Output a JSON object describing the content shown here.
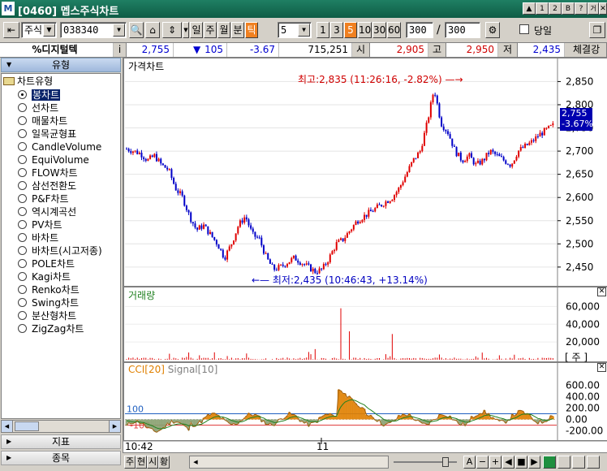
{
  "window": {
    "title": "[0460] 멥스주식차트",
    "logo": "M",
    "controls": [
      "&",
      "1",
      "2",
      "B",
      "?",
      "거",
      "X"
    ]
  },
  "toolbar": {
    "market_label": "주식",
    "code_value": "038340",
    "period_buttons": [
      "일",
      "주",
      "월",
      "분",
      "틱"
    ],
    "active_period": "틱",
    "interval_value": "5",
    "interval_buttons": [
      "1",
      "3",
      "5",
      "10",
      "30",
      "60"
    ],
    "active_interval": "5",
    "count_value": "300",
    "slash": "/",
    "total_value": "300",
    "today_label": "당일"
  },
  "quote": {
    "name": "%디지털텍",
    "info_label": "i",
    "price": "2,755",
    "change_arrow": "▼",
    "change": "105",
    "change_pct": "-3.67",
    "volume": "715,251",
    "open_label": "시",
    "open": "2,905",
    "high_label": "고",
    "high": "2,950",
    "low_label": "저",
    "low": "2,435",
    "exec_label": "체결강"
  },
  "sidebar": {
    "head": "유형",
    "tree_root": "차트유형",
    "items": [
      {
        "label": "봉차트",
        "selected": true
      },
      {
        "label": "선차트",
        "selected": false
      },
      {
        "label": "매물차트",
        "selected": false
      },
      {
        "label": "일목균형표",
        "selected": false
      },
      {
        "label": "CandleVolume",
        "selected": false
      },
      {
        "label": "EquiVolume",
        "selected": false
      },
      {
        "label": "FLOW차트",
        "selected": false
      },
      {
        "label": "삼선전환도",
        "selected": false
      },
      {
        "label": "P&F차트",
        "selected": false
      },
      {
        "label": "역시계곡선",
        "selected": false
      },
      {
        "label": "PV차트",
        "selected": false
      },
      {
        "label": "바차트",
        "selected": false
      },
      {
        "label": "바차트(시고저종)",
        "selected": false
      },
      {
        "label": "POLE차트",
        "selected": false
      },
      {
        "label": "Kagi차트",
        "selected": false
      },
      {
        "label": "Renko차트",
        "selected": false
      },
      {
        "label": "Swing차트",
        "selected": false
      },
      {
        "label": "분산형차트",
        "selected": false
      },
      {
        "label": "ZigZag차트",
        "selected": false
      }
    ],
    "tab_indicator": "지표",
    "tab_stock": "종목"
  },
  "chart": {
    "price_title": "가격차트",
    "volume_title": "거래량",
    "cci_title_1": "CCI[20]",
    "cci_title_2": "Signal[10]",
    "max_label": "최고:2,835 (11:26:16, -2.82%)",
    "min_label": "최저:2,435 (10:46:43, +13.14%)",
    "current_price": "2,755",
    "current_pct": "-3.67%",
    "price_ticks": [
      "2,850",
      "2,800",
      "2,750",
      "2,700",
      "2,650",
      "2,600",
      "2,550",
      "2,500",
      "2,450"
    ],
    "volume_ticks": [
      "60,000",
      "40,000",
      "20,000"
    ],
    "volume_unit": "[ 주 ]",
    "cci_ticks": [
      "600.00",
      "400.00",
      "200.00",
      "0.00",
      "-200.00"
    ],
    "cci_level_100": "100",
    "cci_level_m100": "-100",
    "x_labels": [
      "10:42",
      "11"
    ],
    "colors": {
      "up": "#e00000",
      "down": "#0000c8",
      "cci": "#e08000",
      "signal": "#208020"
    }
  },
  "chart_data": {
    "type": "candlestick",
    "price_range": [
      2420,
      2870
    ],
    "volume_range": [
      0,
      75000
    ],
    "cci_range": [
      -320,
      760
    ],
    "high": 2835,
    "low": 2435,
    "last": 2755,
    "close_path": [
      2705,
      2700,
      2695,
      2680,
      2690,
      2670,
      2660,
      2620,
      2600,
      2560,
      2530,
      2540,
      2520,
      2500,
      2470,
      2500,
      2540,
      2560,
      2520,
      2510,
      2470,
      2445,
      2450,
      2460,
      2470,
      2460,
      2450,
      2440,
      2445,
      2470,
      2500,
      2510,
      2530,
      2550,
      2560,
      2570,
      2580,
      2590,
      2600,
      2620,
      2650,
      2680,
      2700,
      2760,
      2835,
      2760,
      2740,
      2700,
      2680,
      2690,
      2670,
      2680,
      2700,
      2690,
      2680,
      2670,
      2700,
      2710,
      2720,
      2735,
      2745,
      2755
    ],
    "volume_spikes": [
      {
        "pos": 0.5,
        "v": 58000
      },
      {
        "pos": 0.52,
        "v": 32000
      },
      {
        "pos": 0.62,
        "v": 29000
      },
      {
        "pos": 0.44,
        "v": 12000
      }
    ],
    "cci_levels": [
      100,
      -100
    ]
  },
  "bottom": {
    "left_buttons": [
      "주",
      "현",
      "시",
      "황"
    ],
    "right_buttons": [
      "A",
      "−",
      "+",
      "◀",
      "■",
      "▶"
    ]
  }
}
